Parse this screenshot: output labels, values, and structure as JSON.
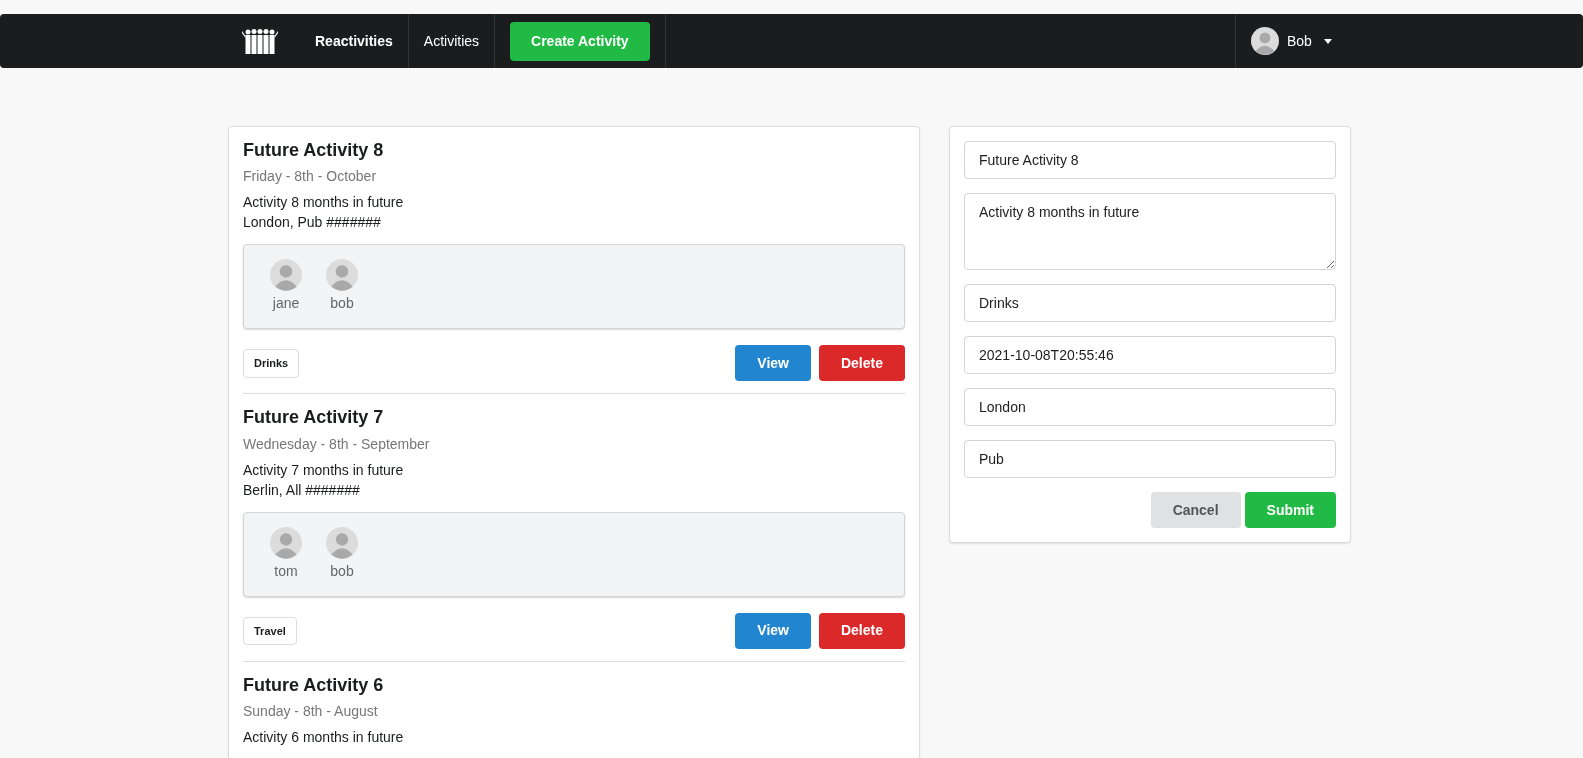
{
  "navbar": {
    "brand": "Reactivities",
    "links": [
      {
        "label": "Activities",
        "selected": false
      }
    ],
    "create_button": "Create Activity",
    "user": {
      "name": "Bob"
    }
  },
  "activities": [
    {
      "title": "Future Activity 8",
      "date": "Friday - 8th - October",
      "description": "Activity 8 months in future",
      "location": "London, Pub #######",
      "attendees": [
        {
          "name": "jane"
        },
        {
          "name": "bob"
        }
      ],
      "category": "Drinks",
      "actions": [
        {
          "kind": "view",
          "label": "View"
        },
        {
          "kind": "delete",
          "label": "Delete"
        }
      ]
    },
    {
      "title": "Future Activity 7",
      "date": "Wednesday - 8th - September",
      "description": "Activity 7 months in future",
      "location": "Berlin, All #######",
      "attendees": [
        {
          "name": "tom"
        },
        {
          "name": "bob"
        }
      ],
      "category": "Travel",
      "actions": [
        {
          "kind": "view",
          "label": "View"
        },
        {
          "kind": "delete",
          "label": "Delete"
        }
      ]
    },
    {
      "title": "Future Activity 6",
      "date": "Sunday - 8th - August",
      "description": "Activity 6 months in future"
    }
  ],
  "form": {
    "fields": [
      {
        "kind": "input",
        "value": "Future Activity 8"
      },
      {
        "kind": "textarea",
        "value": "Activity 8 months in future"
      },
      {
        "kind": "input",
        "value": "Drinks"
      },
      {
        "kind": "input",
        "value": "2021-10-08T20:55:46"
      },
      {
        "kind": "input",
        "value": "London"
      },
      {
        "kind": "input",
        "value": "Pub"
      }
    ],
    "buttons": [
      {
        "kind": "cancel",
        "label": "Cancel"
      },
      {
        "kind": "submit",
        "label": "Submit"
      }
    ]
  }
}
